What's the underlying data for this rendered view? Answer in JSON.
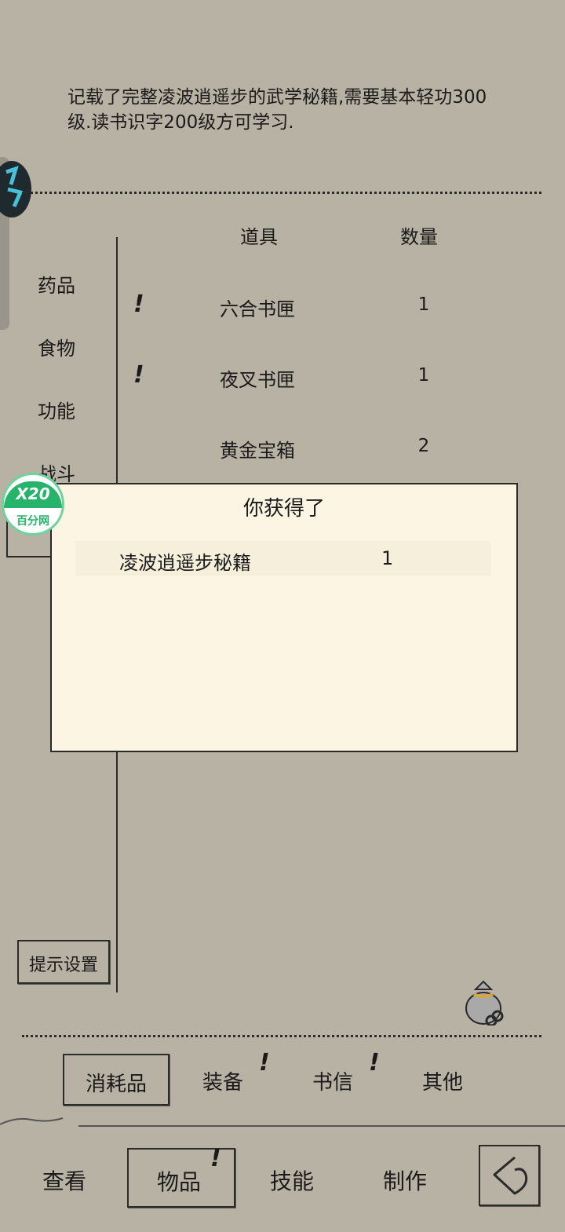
{
  "item_description": "记载了完整凌波逍遥步的武学秘籍,需要基本轻功300级.读书识字200级方可学习.",
  "categories": [
    "药品",
    "食物",
    "功能",
    "战斗"
  ],
  "table_headers": {
    "item": "道具",
    "quantity": "数量"
  },
  "items": [
    {
      "name": "六合书匣",
      "quantity": "1",
      "alert": "!"
    },
    {
      "name": "夜叉书匣",
      "quantity": "1",
      "alert": "!"
    },
    {
      "name": "黄金宝箱",
      "quantity": "2",
      "alert": ""
    }
  ],
  "dialog": {
    "title": "你获得了",
    "item_name": "凌波逍遥步秘籍",
    "item_quantity": "1"
  },
  "hint_settings_label": "提示设置",
  "sub_tabs": [
    {
      "label": "消耗品",
      "selected": true,
      "alert": ""
    },
    {
      "label": "装备",
      "selected": false,
      "alert": "!"
    },
    {
      "label": "书信",
      "selected": false,
      "alert": "!"
    },
    {
      "label": "其他",
      "selected": false,
      "alert": ""
    }
  ],
  "bottom_nav": [
    {
      "label": "查看",
      "selected": false,
      "alert": ""
    },
    {
      "label": "物品",
      "selected": true,
      "alert": "!"
    },
    {
      "label": "技能",
      "selected": false,
      "alert": ""
    },
    {
      "label": "制作",
      "selected": false,
      "alert": ""
    }
  ],
  "watermark": {
    "top": "X20",
    "bottom": "百分网"
  },
  "icons": {
    "bag": "money-bag-icon",
    "back": "back-arrow-icon"
  }
}
